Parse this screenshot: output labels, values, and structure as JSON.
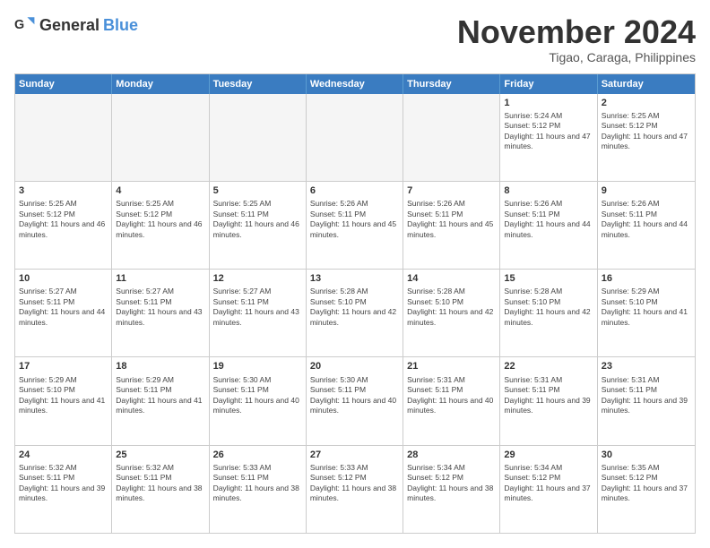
{
  "header": {
    "logo": {
      "general": "General",
      "blue": "Blue"
    },
    "title": "November 2024",
    "location": "Tigao, Caraga, Philippines"
  },
  "calendar": {
    "days_of_week": [
      "Sunday",
      "Monday",
      "Tuesday",
      "Wednesday",
      "Thursday",
      "Friday",
      "Saturday"
    ],
    "weeks": [
      [
        {
          "day": "",
          "empty": true
        },
        {
          "day": "",
          "empty": true
        },
        {
          "day": "",
          "empty": true
        },
        {
          "day": "",
          "empty": true
        },
        {
          "day": "",
          "empty": true
        },
        {
          "day": "1",
          "sunrise": "5:24 AM",
          "sunset": "5:12 PM",
          "daylight": "11 hours and 47 minutes."
        },
        {
          "day": "2",
          "sunrise": "5:25 AM",
          "sunset": "5:12 PM",
          "daylight": "11 hours and 47 minutes."
        }
      ],
      [
        {
          "day": "3",
          "sunrise": "5:25 AM",
          "sunset": "5:12 PM",
          "daylight": "11 hours and 46 minutes."
        },
        {
          "day": "4",
          "sunrise": "5:25 AM",
          "sunset": "5:12 PM",
          "daylight": "11 hours and 46 minutes."
        },
        {
          "day": "5",
          "sunrise": "5:25 AM",
          "sunset": "5:11 PM",
          "daylight": "11 hours and 46 minutes."
        },
        {
          "day": "6",
          "sunrise": "5:26 AM",
          "sunset": "5:11 PM",
          "daylight": "11 hours and 45 minutes."
        },
        {
          "day": "7",
          "sunrise": "5:26 AM",
          "sunset": "5:11 PM",
          "daylight": "11 hours and 45 minutes."
        },
        {
          "day": "8",
          "sunrise": "5:26 AM",
          "sunset": "5:11 PM",
          "daylight": "11 hours and 44 minutes."
        },
        {
          "day": "9",
          "sunrise": "5:26 AM",
          "sunset": "5:11 PM",
          "daylight": "11 hours and 44 minutes."
        }
      ],
      [
        {
          "day": "10",
          "sunrise": "5:27 AM",
          "sunset": "5:11 PM",
          "daylight": "11 hours and 44 minutes."
        },
        {
          "day": "11",
          "sunrise": "5:27 AM",
          "sunset": "5:11 PM",
          "daylight": "11 hours and 43 minutes."
        },
        {
          "day": "12",
          "sunrise": "5:27 AM",
          "sunset": "5:11 PM",
          "daylight": "11 hours and 43 minutes."
        },
        {
          "day": "13",
          "sunrise": "5:28 AM",
          "sunset": "5:10 PM",
          "daylight": "11 hours and 42 minutes."
        },
        {
          "day": "14",
          "sunrise": "5:28 AM",
          "sunset": "5:10 PM",
          "daylight": "11 hours and 42 minutes."
        },
        {
          "day": "15",
          "sunrise": "5:28 AM",
          "sunset": "5:10 PM",
          "daylight": "11 hours and 42 minutes."
        },
        {
          "day": "16",
          "sunrise": "5:29 AM",
          "sunset": "5:10 PM",
          "daylight": "11 hours and 41 minutes."
        }
      ],
      [
        {
          "day": "17",
          "sunrise": "5:29 AM",
          "sunset": "5:10 PM",
          "daylight": "11 hours and 41 minutes."
        },
        {
          "day": "18",
          "sunrise": "5:29 AM",
          "sunset": "5:11 PM",
          "daylight": "11 hours and 41 minutes."
        },
        {
          "day": "19",
          "sunrise": "5:30 AM",
          "sunset": "5:11 PM",
          "daylight": "11 hours and 40 minutes."
        },
        {
          "day": "20",
          "sunrise": "5:30 AM",
          "sunset": "5:11 PM",
          "daylight": "11 hours and 40 minutes."
        },
        {
          "day": "21",
          "sunrise": "5:31 AM",
          "sunset": "5:11 PM",
          "daylight": "11 hours and 40 minutes."
        },
        {
          "day": "22",
          "sunrise": "5:31 AM",
          "sunset": "5:11 PM",
          "daylight": "11 hours and 39 minutes."
        },
        {
          "day": "23",
          "sunrise": "5:31 AM",
          "sunset": "5:11 PM",
          "daylight": "11 hours and 39 minutes."
        }
      ],
      [
        {
          "day": "24",
          "sunrise": "5:32 AM",
          "sunset": "5:11 PM",
          "daylight": "11 hours and 39 minutes."
        },
        {
          "day": "25",
          "sunrise": "5:32 AM",
          "sunset": "5:11 PM",
          "daylight": "11 hours and 38 minutes."
        },
        {
          "day": "26",
          "sunrise": "5:33 AM",
          "sunset": "5:11 PM",
          "daylight": "11 hours and 38 minutes."
        },
        {
          "day": "27",
          "sunrise": "5:33 AM",
          "sunset": "5:12 PM",
          "daylight": "11 hours and 38 minutes."
        },
        {
          "day": "28",
          "sunrise": "5:34 AM",
          "sunset": "5:12 PM",
          "daylight": "11 hours and 38 minutes."
        },
        {
          "day": "29",
          "sunrise": "5:34 AM",
          "sunset": "5:12 PM",
          "daylight": "11 hours and 37 minutes."
        },
        {
          "day": "30",
          "sunrise": "5:35 AM",
          "sunset": "5:12 PM",
          "daylight": "11 hours and 37 minutes."
        }
      ]
    ]
  }
}
